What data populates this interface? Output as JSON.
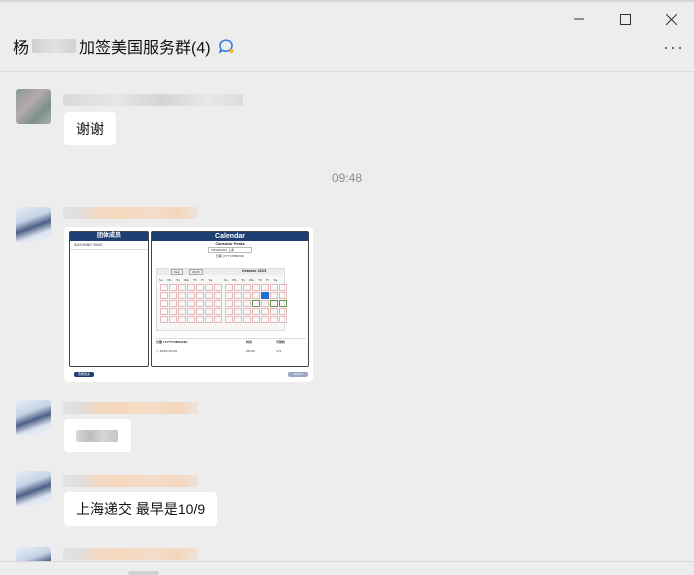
{
  "window": {
    "controls": {
      "minimize": "─",
      "maximize": "☐",
      "close": "✕"
    }
  },
  "header": {
    "title_prefix": "杨",
    "title_suffix": "加签美国服务群(4)",
    "badge_icon": "chat-bubble-icon",
    "more_label": "···"
  },
  "messages": [
    {
      "type": "text",
      "avatar": "avatar-a",
      "text": "谢谢"
    },
    {
      "type": "time",
      "text": "09:48"
    },
    {
      "type": "image",
      "avatar": "avatar-b",
      "screenshot": {
        "left_title": "团体成员",
        "left_member": "XIAOYANG YANG",
        "cal_title": "Calendar",
        "consular_label": "Consular Posts",
        "post_value": "SHANGHAI 上海",
        "date_label": "日期 (YYYY/MM/DD)",
        "month_left": "Sep",
        "year_left": "2025",
        "month_right": "October 2025",
        "days": [
          "Su",
          "Mo",
          "Tu",
          "We",
          "Th",
          "Fr",
          "Sa"
        ],
        "table_headers": [
          "日期 (YYYY/MM/DD)",
          "时间",
          "可预约"
        ],
        "table_row": [
          "2025/10/09",
          "08:00",
          "171"
        ],
        "left_button": "查看更多",
        "right_button": "Submit"
      }
    },
    {
      "type": "text",
      "avatar": "avatar-b",
      "text": ""
    },
    {
      "type": "text",
      "avatar": "avatar-b",
      "text": "上海递交 最早是10/9"
    }
  ]
}
